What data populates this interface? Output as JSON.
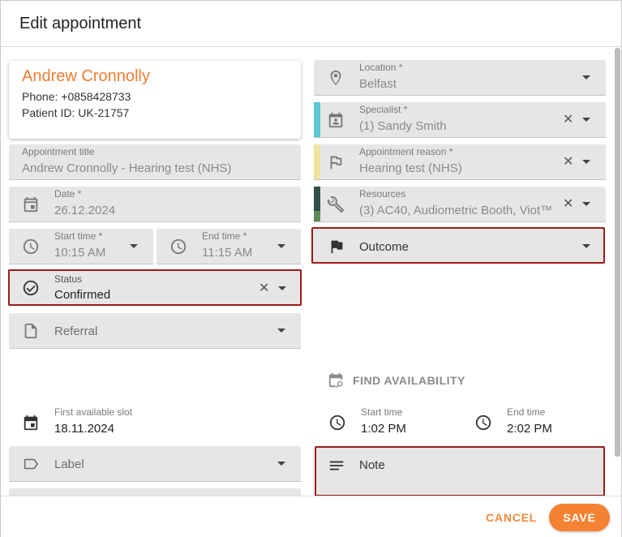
{
  "dialog": {
    "title": "Edit appointment"
  },
  "patient": {
    "name": "Andrew Cronnolly",
    "phone": "Phone: +0858428733",
    "patient_id": "Patient ID: UK-21757"
  },
  "fields": {
    "appointment_title": {
      "label": "Appointment title",
      "value": "Andrew Cronnolly - Hearing test (NHS)"
    },
    "date": {
      "label": "Date *",
      "value": "26.12.2024"
    },
    "start_time": {
      "label": "Start time *",
      "value": "10:15 AM"
    },
    "end_time": {
      "label": "End time *",
      "value": "11:15 AM"
    },
    "status": {
      "label": "Status",
      "value": "Confirmed"
    },
    "referral": {
      "placeholder": "Referral"
    },
    "label": {
      "placeholder": "Label"
    },
    "location": {
      "label": "Location *",
      "value": "Belfast"
    },
    "specialist": {
      "label": "Specialist *",
      "value": "(1) Sandy Smith",
      "color": "#5bc8d4"
    },
    "reason": {
      "label": "Appointment reason *",
      "value": "Hearing test (NHS)",
      "color": "#f0e4a0"
    },
    "resources": {
      "label": "Resources",
      "value": "(3) AC40, Audiometric Booth, Viot™",
      "color_top": "#2f4f48",
      "color_bottom": "#5e8a56"
    },
    "outcome": {
      "placeholder": "Outcome"
    },
    "note": {
      "placeholder": "Note"
    }
  },
  "availability": {
    "find_label": "FIND AVAILABILITY",
    "first_slot_label": "First available slot",
    "first_slot_value": "18.11.2024",
    "start_label": "Start time",
    "start_value": "1:02 PM",
    "end_label": "End time",
    "end_value": "2:02 PM"
  },
  "footer": {
    "cancel": "CANCEL",
    "save": "SAVE"
  },
  "colors": {
    "accent": "#f58233",
    "highlight_border": "#9e1b1b"
  }
}
